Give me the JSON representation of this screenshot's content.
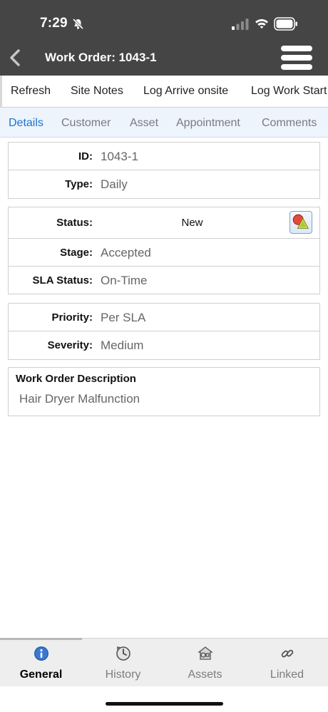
{
  "status_bar": {
    "time": "7:29"
  },
  "nav": {
    "title": "Work Order: 1043-1"
  },
  "actions": [
    "Refresh",
    "Site Notes",
    "Log Arrive onsite",
    "Log Work Start"
  ],
  "tabs": [
    {
      "label": "Details",
      "active": true
    },
    {
      "label": "Customer"
    },
    {
      "label": "Asset"
    },
    {
      "label": "Appointment"
    },
    {
      "label": "Comments"
    }
  ],
  "fields": {
    "id": {
      "label": "ID:",
      "value": "1043-1"
    },
    "type": {
      "label": "Type:",
      "value": "Daily"
    },
    "status": {
      "label": "Status:",
      "value": "New"
    },
    "stage": {
      "label": "Stage:",
      "value": "Accepted"
    },
    "sla_status": {
      "label": "SLA Status:",
      "value": "On-Time"
    },
    "priority": {
      "label": "Priority:",
      "value": "Per SLA"
    },
    "severity": {
      "label": "Severity:",
      "value": "Medium"
    }
  },
  "description": {
    "title": "Work Order Description",
    "text": "Hair Dryer Malfunction"
  },
  "bottom_tabs": [
    {
      "label": "General",
      "icon": "info-icon",
      "active": true
    },
    {
      "label": "History",
      "icon": "history-icon"
    },
    {
      "label": "Assets",
      "icon": "assets-icon"
    },
    {
      "label": "Linked",
      "icon": "link-icon"
    }
  ],
  "colors": {
    "header_bg": "#454545",
    "tab_active": "#1c74d2",
    "tab_bar_bg": "#eef4fb"
  }
}
